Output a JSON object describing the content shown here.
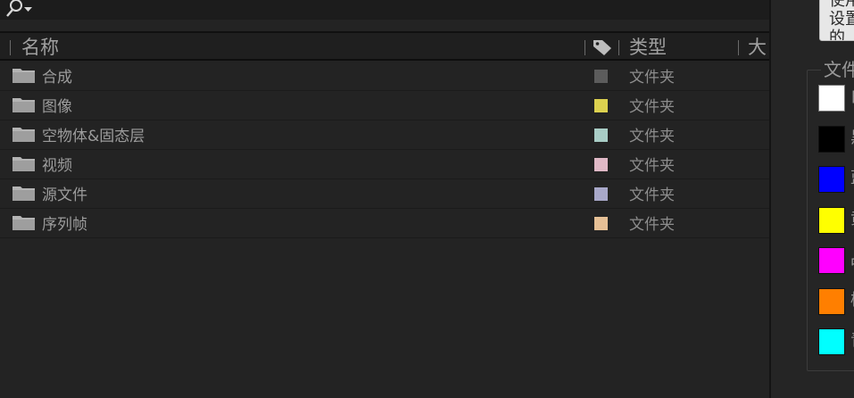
{
  "header": {
    "name_col": "名称",
    "type_col": "类型",
    "size_col": "大"
  },
  "rows": [
    {
      "name": "合成",
      "type": "文件夹",
      "label_color": "#5c5c5c"
    },
    {
      "name": "图像",
      "type": "文件夹",
      "label_color": "#dcd14f"
    },
    {
      "name": "空物体&固态层",
      "type": "文件夹",
      "label_color": "#a9cdc6"
    },
    {
      "name": "视频",
      "type": "文件夹",
      "label_color": "#e0b9c6"
    },
    {
      "name": "源文件",
      "type": "文件夹",
      "label_color": "#a8a8c9"
    },
    {
      "name": "序列帧",
      "type": "文件夹",
      "label_color": "#e6c096"
    }
  ],
  "settings": {
    "desc_lines": [
      "使用",
      "设置",
      "的"
    ],
    "group_title": "文件",
    "colors": [
      {
        "hex": "#ffffff",
        "label": "白"
      },
      {
        "hex": "#000000",
        "label": "黑"
      },
      {
        "hex": "#0000ff",
        "label": "蓝"
      },
      {
        "hex": "#ffff00",
        "label": "黄"
      },
      {
        "hex": "#ff00ff",
        "label": "品"
      },
      {
        "hex": "#ff7f00",
        "label": "橙"
      },
      {
        "hex": "#00ffff",
        "label": "青"
      }
    ]
  },
  "icons": {
    "search": "search-icon",
    "tag": "tag-icon",
    "folder": "folder-icon"
  }
}
